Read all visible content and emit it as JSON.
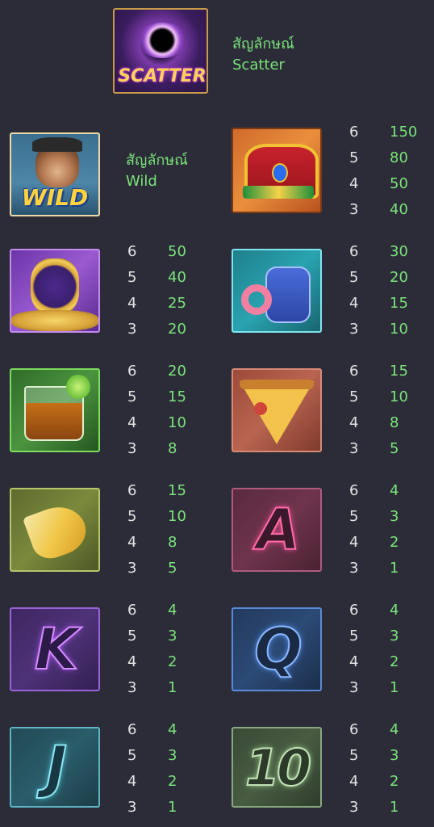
{
  "scatter": {
    "title_th": "สัญลักษณ์",
    "title_en": "Scatter",
    "badge": "SCATTER"
  },
  "wild": {
    "title_th": "สัญลักษณ์",
    "title_en": "Wild",
    "badge": "WILD"
  },
  "paytable": {
    "crown": [
      {
        "count": "6",
        "value": "150"
      },
      {
        "count": "5",
        "value": "80"
      },
      {
        "count": "4",
        "value": "50"
      },
      {
        "count": "3",
        "value": "40"
      }
    ],
    "watch": [
      {
        "count": "6",
        "value": "50"
      },
      {
        "count": "5",
        "value": "40"
      },
      {
        "count": "4",
        "value": "25"
      },
      {
        "count": "3",
        "value": "20"
      }
    ],
    "potion": [
      {
        "count": "6",
        "value": "30"
      },
      {
        "count": "5",
        "value": "20"
      },
      {
        "count": "4",
        "value": "15"
      },
      {
        "count": "3",
        "value": "10"
      }
    ],
    "whiskey": [
      {
        "count": "6",
        "value": "20"
      },
      {
        "count": "5",
        "value": "15"
      },
      {
        "count": "4",
        "value": "10"
      },
      {
        "count": "3",
        "value": "8"
      }
    ],
    "pizza": [
      {
        "count": "6",
        "value": "15"
      },
      {
        "count": "5",
        "value": "10"
      },
      {
        "count": "4",
        "value": "8"
      },
      {
        "count": "3",
        "value": "5"
      }
    ],
    "banana": [
      {
        "count": "6",
        "value": "15"
      },
      {
        "count": "5",
        "value": "10"
      },
      {
        "count": "4",
        "value": "8"
      },
      {
        "count": "3",
        "value": "5"
      }
    ],
    "ace": [
      {
        "count": "6",
        "value": "4"
      },
      {
        "count": "5",
        "value": "3"
      },
      {
        "count": "4",
        "value": "2"
      },
      {
        "count": "3",
        "value": "1"
      }
    ],
    "king": [
      {
        "count": "6",
        "value": "4"
      },
      {
        "count": "5",
        "value": "3"
      },
      {
        "count": "4",
        "value": "2"
      },
      {
        "count": "3",
        "value": "1"
      }
    ],
    "queen": [
      {
        "count": "6",
        "value": "4"
      },
      {
        "count": "5",
        "value": "3"
      },
      {
        "count": "4",
        "value": "2"
      },
      {
        "count": "3",
        "value": "1"
      }
    ],
    "jack": [
      {
        "count": "6",
        "value": "4"
      },
      {
        "count": "5",
        "value": "3"
      },
      {
        "count": "4",
        "value": "2"
      },
      {
        "count": "3",
        "value": "1"
      }
    ],
    "ten": [
      {
        "count": "6",
        "value": "4"
      },
      {
        "count": "5",
        "value": "3"
      },
      {
        "count": "4",
        "value": "2"
      },
      {
        "count": "3",
        "value": "1"
      }
    ]
  },
  "letters": {
    "ace": "A",
    "king": "K",
    "queen": "Q",
    "jack": "J",
    "ten": "10"
  },
  "colors": {
    "payout_value": "#7be37b",
    "payout_count": "#e3e3e3",
    "background": "#2b2c37"
  }
}
